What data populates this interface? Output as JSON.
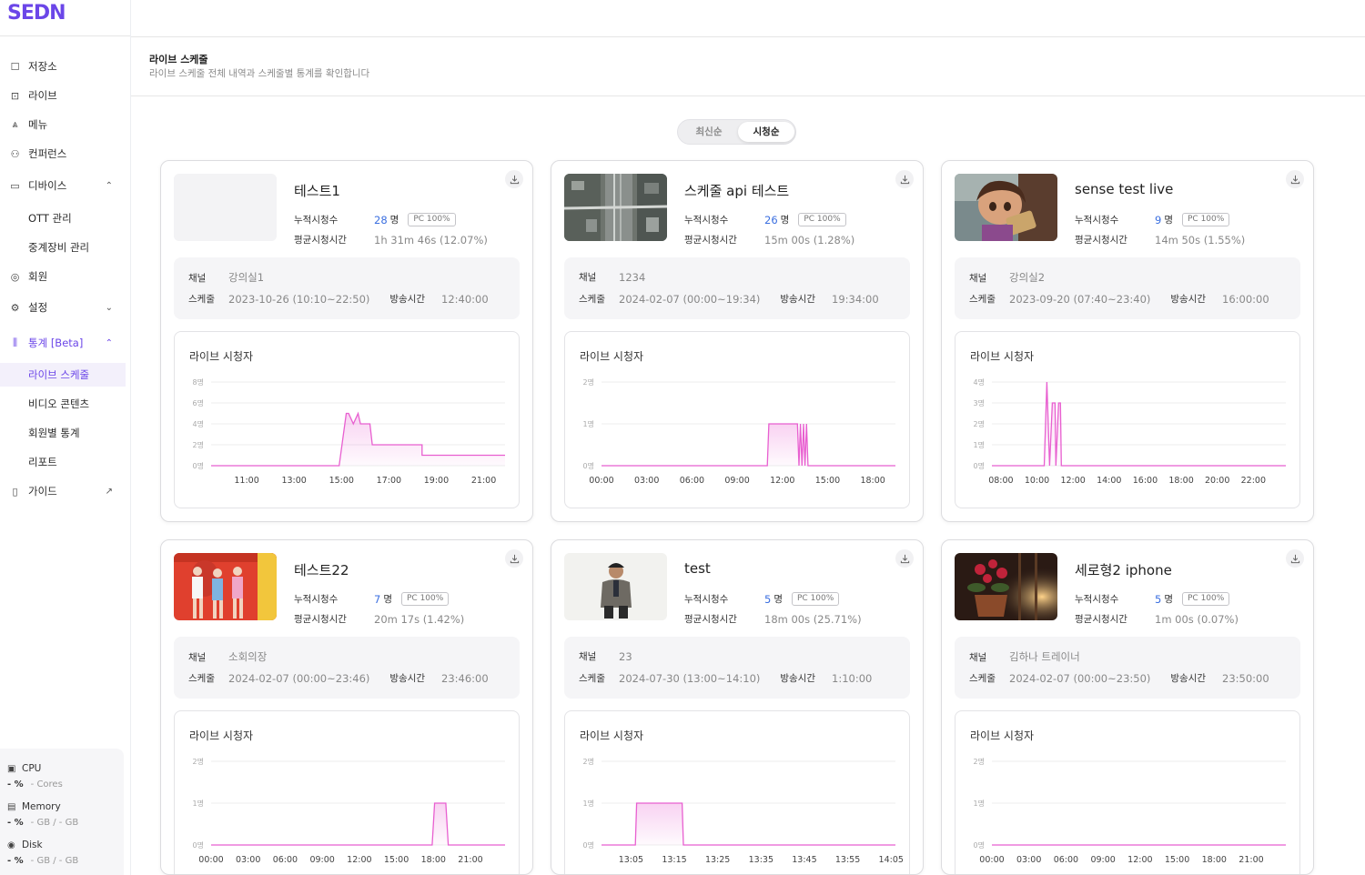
{
  "app": {
    "logo": "SEDN"
  },
  "sidebar": {
    "items": [
      {
        "label": "저장소",
        "icon": "storage-icon"
      },
      {
        "label": "라이브",
        "icon": "live-icon"
      },
      {
        "label": "메뉴",
        "icon": "menu-icon"
      },
      {
        "label": "컨퍼런스",
        "icon": "conference-icon"
      },
      {
        "label": "디바이스",
        "icon": "device-icon"
      },
      {
        "label": "OTT 관리"
      },
      {
        "label": "중계장비 관리"
      },
      {
        "label": "회원",
        "icon": "member-icon"
      },
      {
        "label": "설정",
        "icon": "settings-icon"
      },
      {
        "label": "통계 [Beta]",
        "icon": "stats-icon"
      },
      {
        "label": "라이브 스케줄"
      },
      {
        "label": "비디오 콘텐츠"
      },
      {
        "label": "회원별 통계"
      },
      {
        "label": "리포트"
      },
      {
        "label": "가이드",
        "icon": "guide-icon"
      }
    ]
  },
  "system": {
    "cpu": {
      "label": "CPU",
      "percent": "- %",
      "detail": "- Cores"
    },
    "memory": {
      "label": "Memory",
      "percent": "- %",
      "detail": "- GB / - GB"
    },
    "disk": {
      "label": "Disk",
      "percent": "- %",
      "detail": "- GB / - GB"
    }
  },
  "page": {
    "title": "라이브 스케줄",
    "subtitle": "라이브 스케줄 전체 내역과 스케줄별 통계를 확인합니다"
  },
  "sort": {
    "latest": "최신순",
    "views": "시청순",
    "selected": "시청순"
  },
  "labels": {
    "total_viewers": "누적시청수",
    "avg_watch": "평균시청시간",
    "channel": "채널",
    "schedule": "스케줄",
    "broadcast_time": "방송시간",
    "chart_title": "라이브 시청자",
    "viewers_unit": "명"
  },
  "colors": {
    "accent": "#6b46e8",
    "chart_line": "#e85fd0",
    "viewers_count": "#3b6fe0"
  },
  "cards": [
    {
      "title": "테스트1",
      "viewers": "28",
      "badge": "PC 100%",
      "avg": "1h 31m 46s (12.07%)",
      "channel": "강의실1",
      "schedule": "2023-10-26 (10:10~22:50)",
      "broadcast": "12:40:00",
      "thumb": "blank"
    },
    {
      "title": "스케줄 api 테스트",
      "viewers": "26",
      "badge": "PC 100%",
      "avg": "15m 00s (1.28%)",
      "channel": "1234",
      "schedule": "2024-02-07 (00:00~19:34)",
      "broadcast": "19:34:00",
      "thumb": "aerial-city"
    },
    {
      "title": "sense test live",
      "viewers": "9",
      "badge": "PC 100%",
      "avg": "14m 50s (1.55%)",
      "channel": "강의실2",
      "schedule": "2023-09-20 (07:40~23:40)",
      "broadcast": "16:00:00",
      "thumb": "animated-girl"
    },
    {
      "title": "테스트22",
      "viewers": "7",
      "badge": "PC 100%",
      "avg": "20m 17s (1.42%)",
      "channel": "소회의장",
      "schedule": "2024-02-07 (00:00~23:46)",
      "broadcast": "23:46:00",
      "thumb": "dancers-red"
    },
    {
      "title": "test",
      "viewers": "5",
      "badge": "PC 100%",
      "avg": "18m 00s (25.71%)",
      "channel": "23",
      "schedule": "2024-07-30 (13:00~14:10)",
      "broadcast": "1:10:00",
      "thumb": "man-suit"
    },
    {
      "title": "세로형2 iphone",
      "viewers": "5",
      "badge": "PC 100%",
      "avg": "1m 00s (0.07%)",
      "channel": "김하나 트레이너",
      "schedule": "2024-02-07 (00:00~23:50)",
      "broadcast": "23:50:00",
      "thumb": "flowers-sunset"
    }
  ],
  "chart_data": [
    {
      "type": "area",
      "y_ticks": [
        "8명",
        "6명",
        "4명",
        "2명",
        "0명"
      ],
      "ylim": [
        0,
        8
      ],
      "x_ticks": [
        "11:00",
        "13:00",
        "15:00",
        "17:00",
        "19:00",
        "21:00"
      ],
      "xlim": [
        9.5,
        21.9
      ],
      "x": [
        9.5,
        14.9,
        15.2,
        15.3,
        15.5,
        15.7,
        15.8,
        16.2,
        16.3,
        18.4,
        18.4,
        21.9
      ],
      "y": [
        0,
        0,
        5,
        5,
        4,
        5,
        4,
        4,
        2,
        2,
        1,
        1
      ]
    },
    {
      "type": "area",
      "y_ticks": [
        "2명",
        "1명",
        "0명"
      ],
      "ylim": [
        0,
        2
      ],
      "x_ticks": [
        "00:00",
        "03:00",
        "06:00",
        "09:00",
        "12:00",
        "15:00",
        "18:00"
      ],
      "xlim": [
        0,
        19.5
      ],
      "x": [
        0,
        11.0,
        11.1,
        13.0,
        13.1,
        13.2,
        13.3,
        13.4,
        13.5,
        13.6,
        13.7,
        13.8,
        19.5
      ],
      "y": [
        0,
        0,
        1,
        1,
        0,
        1,
        0,
        1,
        0,
        1,
        0,
        0,
        0
      ]
    },
    {
      "type": "area",
      "y_ticks": [
        "4명",
        "3명",
        "2명",
        "1명",
        "0명"
      ],
      "ylim": [
        0,
        4
      ],
      "x_ticks": [
        "08:00",
        "10:00",
        "12:00",
        "14:00",
        "16:00",
        "18:00",
        "20:00",
        "22:00"
      ],
      "xlim": [
        7.5,
        23.8
      ],
      "x": [
        7.5,
        10.4,
        10.55,
        10.7,
        10.85,
        11.0,
        11.05,
        11.2,
        11.3,
        11.35,
        23.8
      ],
      "y": [
        0,
        0,
        4,
        0,
        3,
        3,
        0,
        3,
        3,
        0,
        0
      ]
    },
    {
      "type": "area",
      "y_ticks": [
        "2명",
        "1명",
        "0명"
      ],
      "ylim": [
        0,
        2
      ],
      "x_ticks": [
        "00:00",
        "03:00",
        "06:00",
        "09:00",
        "12:00",
        "15:00",
        "18:00",
        "21:00"
      ],
      "xlim": [
        0,
        23.8
      ],
      "x": [
        0,
        17.9,
        18.1,
        19.0,
        19.2,
        23.8
      ],
      "y": [
        0,
        0,
        1,
        1,
        0,
        0
      ]
    },
    {
      "type": "area",
      "y_ticks": [
        "2명",
        "1명",
        "0명"
      ],
      "ylim": [
        0,
        2
      ],
      "x_ticks": [
        "13:05",
        "13:15",
        "13:25",
        "13:35",
        "13:45",
        "13:55",
        "14:05"
      ],
      "xlim": [
        12.97,
        14.1
      ],
      "x": [
        12.97,
        13.1,
        13.105,
        13.28,
        13.285,
        14.1
      ],
      "y": [
        0,
        0,
        1,
        1,
        0,
        0
      ]
    },
    {
      "type": "area",
      "y_ticks": [
        "2명",
        "1명",
        "0명"
      ],
      "ylim": [
        0,
        2
      ],
      "x_ticks": [
        "00:00",
        "03:00",
        "06:00",
        "09:00",
        "12:00",
        "15:00",
        "18:00",
        "21:00"
      ],
      "xlim": [
        0,
        23.8
      ],
      "x": [
        0,
        23.8
      ],
      "y": [
        0,
        0
      ]
    }
  ]
}
